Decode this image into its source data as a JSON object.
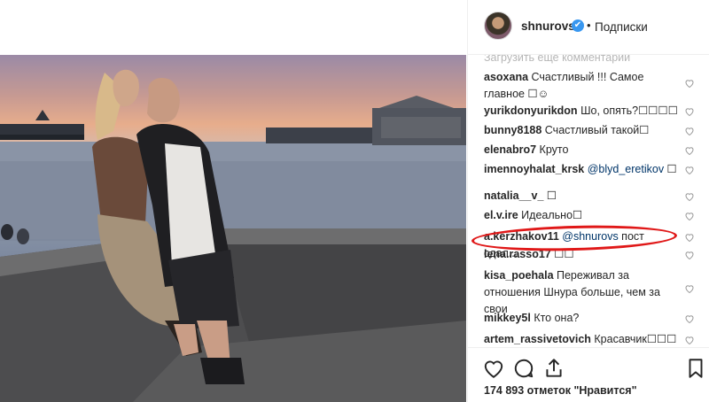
{
  "post": {
    "username": "shnurovs",
    "verified_mark": "✔",
    "separator": "•",
    "follow_label": "Подписки",
    "load_more": "Загрузить еще комментарии",
    "likes_text": "174 893 отметок \"Нравится\""
  },
  "comments": [
    {
      "user": "asoxana",
      "text": "Счастливый !!! Самое главное ☐☺"
    },
    {
      "user": "yurikdonyurikdon",
      "text": "Шо, опять?☐☐☐☐"
    },
    {
      "user": "bunny8188",
      "text": "Счастливый такой☐"
    },
    {
      "user": "elenabro7",
      "text": "Круто"
    },
    {
      "user": "imennoyhalat_krsk",
      "text": "",
      "mention": "@blyd_eretikov",
      "after": " ☐"
    },
    {
      "user": "natalia__v_",
      "text": "☐"
    },
    {
      "user": "el.v.ire",
      "text": "Идеально☐"
    },
    {
      "user": "a.kerzhakov11",
      "text": "",
      "mention": "@shnurovs",
      "after": " пост сдал..."
    },
    {
      "user": "lena.rasso17",
      "text": "☐☐"
    },
    {
      "user": "kisa_poehala",
      "text": "Переживал за отношения Шнура больше, чем за свои"
    },
    {
      "user": "mikkey5l",
      "text": "Кто она?"
    },
    {
      "user": "artem_rassivetovich",
      "text": "Красавчик☐☐☐"
    }
  ],
  "icons": {
    "heart": "heart-outline-icon",
    "comment": "comment-bubble-icon",
    "share": "share-icon",
    "bookmark": "bookmark-icon"
  }
}
